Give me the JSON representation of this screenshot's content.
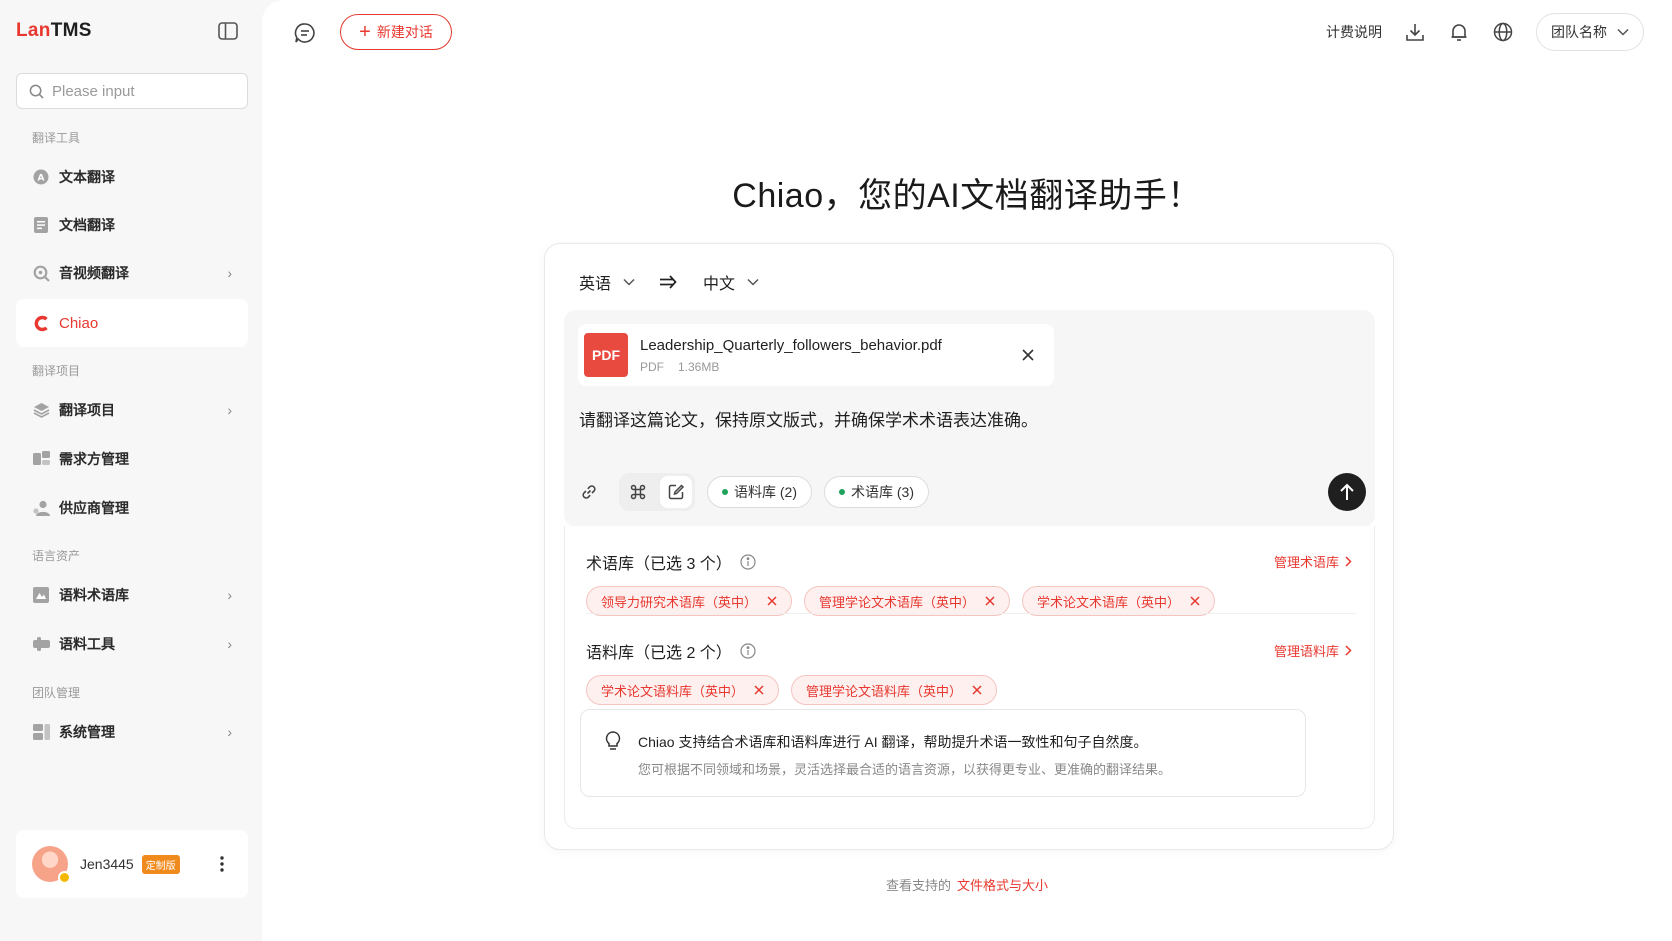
{
  "brand": {
    "prefix": "Lan",
    "suffix": "TMS",
    "accent_color": "#e8382f"
  },
  "search": {
    "placeholder": "Please input"
  },
  "sidebar": {
    "sections": [
      {
        "title": "翻译工具"
      },
      {
        "title": "翻译项目"
      },
      {
        "title": "语言资产"
      },
      {
        "title": "团队管理"
      }
    ],
    "items": [
      {
        "label": "文本翻译",
        "icon": "text-translate-icon"
      },
      {
        "label": "文档翻译",
        "icon": "document-icon"
      },
      {
        "label": "音视频翻译",
        "icon": "media-search-icon",
        "chevron": "›"
      },
      {
        "label": "Chiao",
        "icon": "chiao-logo-icon",
        "active": true
      },
      {
        "label": "翻译项目",
        "icon": "layers-icon",
        "chevron": "›"
      },
      {
        "label": "需求方管理",
        "icon": "client-icon"
      },
      {
        "label": "供应商管理",
        "icon": "supplier-icon"
      },
      {
        "label": "语料术语库",
        "icon": "corpus-icon",
        "chevron": "›"
      },
      {
        "label": "语料工具",
        "icon": "tools-icon",
        "chevron": "›"
      },
      {
        "label": "系统管理",
        "icon": "system-icon",
        "chevron": "›"
      }
    ]
  },
  "user": {
    "name": "Jen3445",
    "badge": "定制版"
  },
  "header": {
    "new_chat_label": "新建对话",
    "billing_label": "计费说明",
    "team_label": "团队名称"
  },
  "hero": {
    "title": "Chiao，您的AI文档翻译助手！"
  },
  "composer": {
    "source_lang": "英语",
    "target_lang": "中文",
    "swap_symbol": "⇒",
    "file": {
      "type_badge": "PDF",
      "name": "Leadership_Quarterly_followers_behavior.pdf",
      "type": "PDF",
      "size": "1.36MB"
    },
    "prompt": "请翻译这篇论文，保持原文版式，并确保学术术语表达准确。",
    "chips": [
      {
        "label": "语料库 (2)"
      },
      {
        "label": "术语库 (3)"
      }
    ]
  },
  "termbase": {
    "title": "术语库（已选 3 个）",
    "manage_label": "管理术语库",
    "tags": [
      "领导力研究术语库（英中）",
      "管理学论文术语库（英中）",
      "学术论文术语库（英中）"
    ]
  },
  "corpus": {
    "title": "语料库（已选 2 个）",
    "manage_label": "管理语料库",
    "tags": [
      "学术论文语料库（英中）",
      "管理学论文语料库（英中）"
    ]
  },
  "tip": {
    "main": "Chiao 支持结合术语库和语料库进行 AI 翻译，帮助提升术语一致性和句子自然度。",
    "sub": "您可根据不同领域和场景，灵活选择最合适的语言资源，以获得更专业、更准确的翻译结果。"
  },
  "footer": {
    "prefix": "查看支持的",
    "link": "文件格式与大小"
  }
}
